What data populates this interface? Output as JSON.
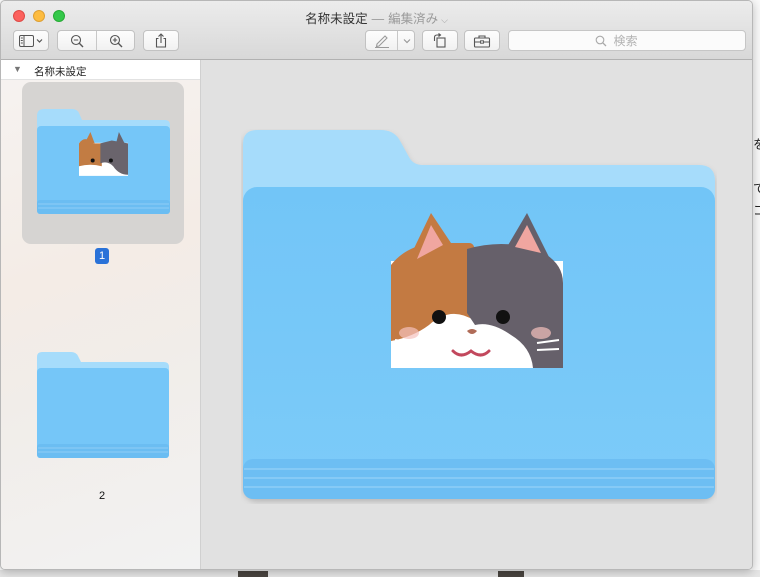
{
  "window": {
    "title": "名称未設定",
    "separator": "—",
    "status": "編集済み"
  },
  "toolbar": {
    "sidebar_button": "sidebar-toggle-icon",
    "zoom_out": "zoom-out-icon",
    "zoom_in": "zoom-in-icon",
    "share": "share-icon",
    "markup": "pen-icon",
    "rotate": "rotate-icon",
    "toolbox": "toolbox-icon"
  },
  "search": {
    "placeholder": "検索"
  },
  "sidebar": {
    "document_name": "名称未設定",
    "pages": [
      {
        "number": "1",
        "selected": true
      },
      {
        "number": "2",
        "selected": false
      }
    ]
  },
  "background": {
    "glyph_1": "を",
    "glyph_2": "で",
    "glyph_3": "コ"
  },
  "colors": {
    "folder_light": "#a6dcfb",
    "folder_main": "#75c6f8",
    "selection": "#2a72d8"
  }
}
